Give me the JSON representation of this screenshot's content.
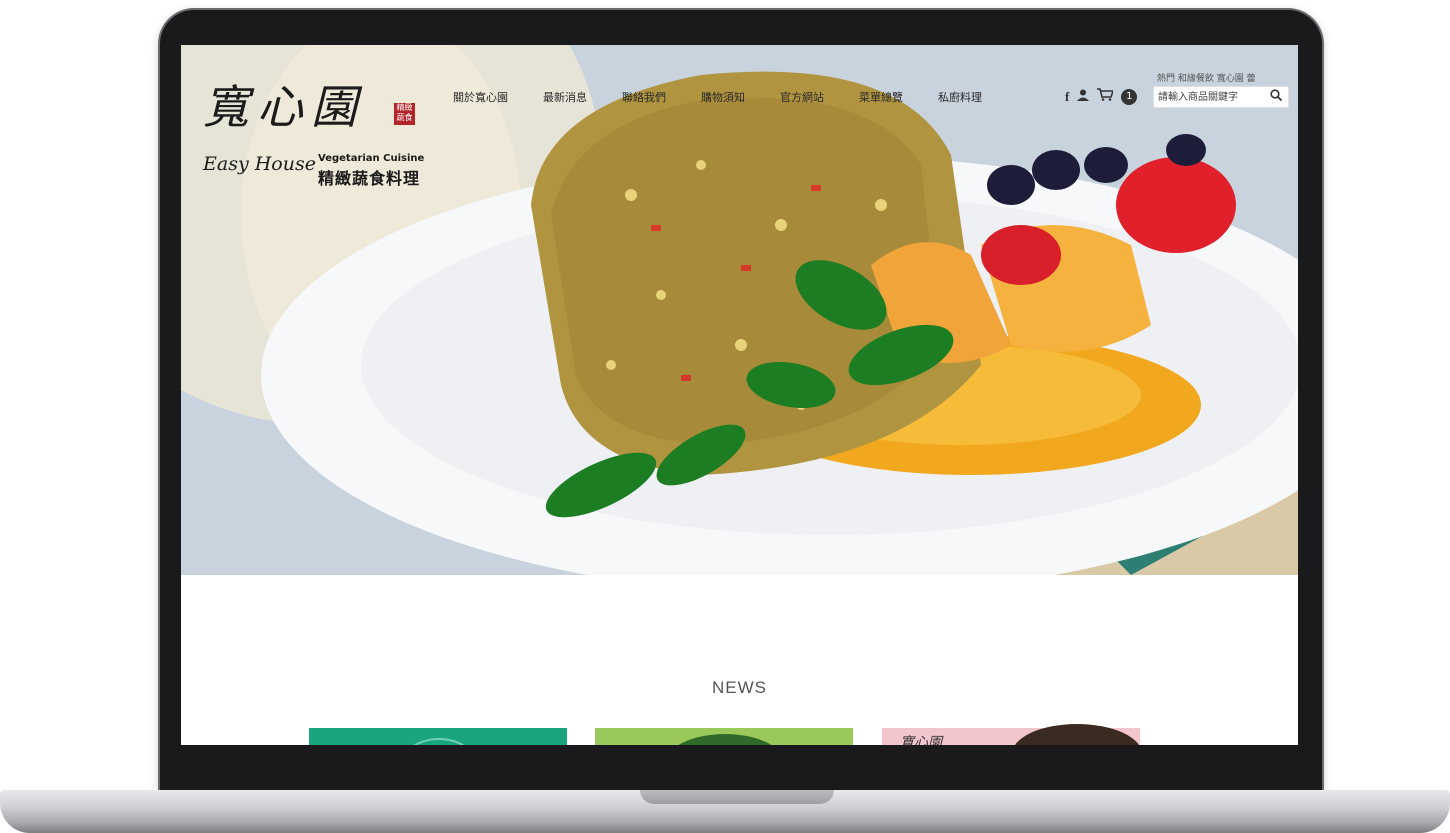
{
  "brand": {
    "name_cn": "寬心園",
    "seal": "精緻蔬食",
    "name_en": "Easy House",
    "cuisine": "Vegetarian Cuisine",
    "subtitle": "精緻蔬食料理"
  },
  "nav": {
    "items": [
      "關於寬心園",
      "最新消息",
      "聯絡我們",
      "購物須知",
      "官方網站",
      "菜單總覽",
      "私廚料理"
    ]
  },
  "tools": {
    "facebook_icon": "f",
    "member_icon": "👤",
    "cart_icon": "🛒",
    "cart_count": "1",
    "hot_keywords": "熱門 和緣餐飲 寬心園 蕾",
    "search_placeholder": "請輸入商品關鍵字",
    "search_icon": "🔍"
  },
  "news": {
    "title": "NEWS",
    "card3_mark": "寬心園"
  }
}
